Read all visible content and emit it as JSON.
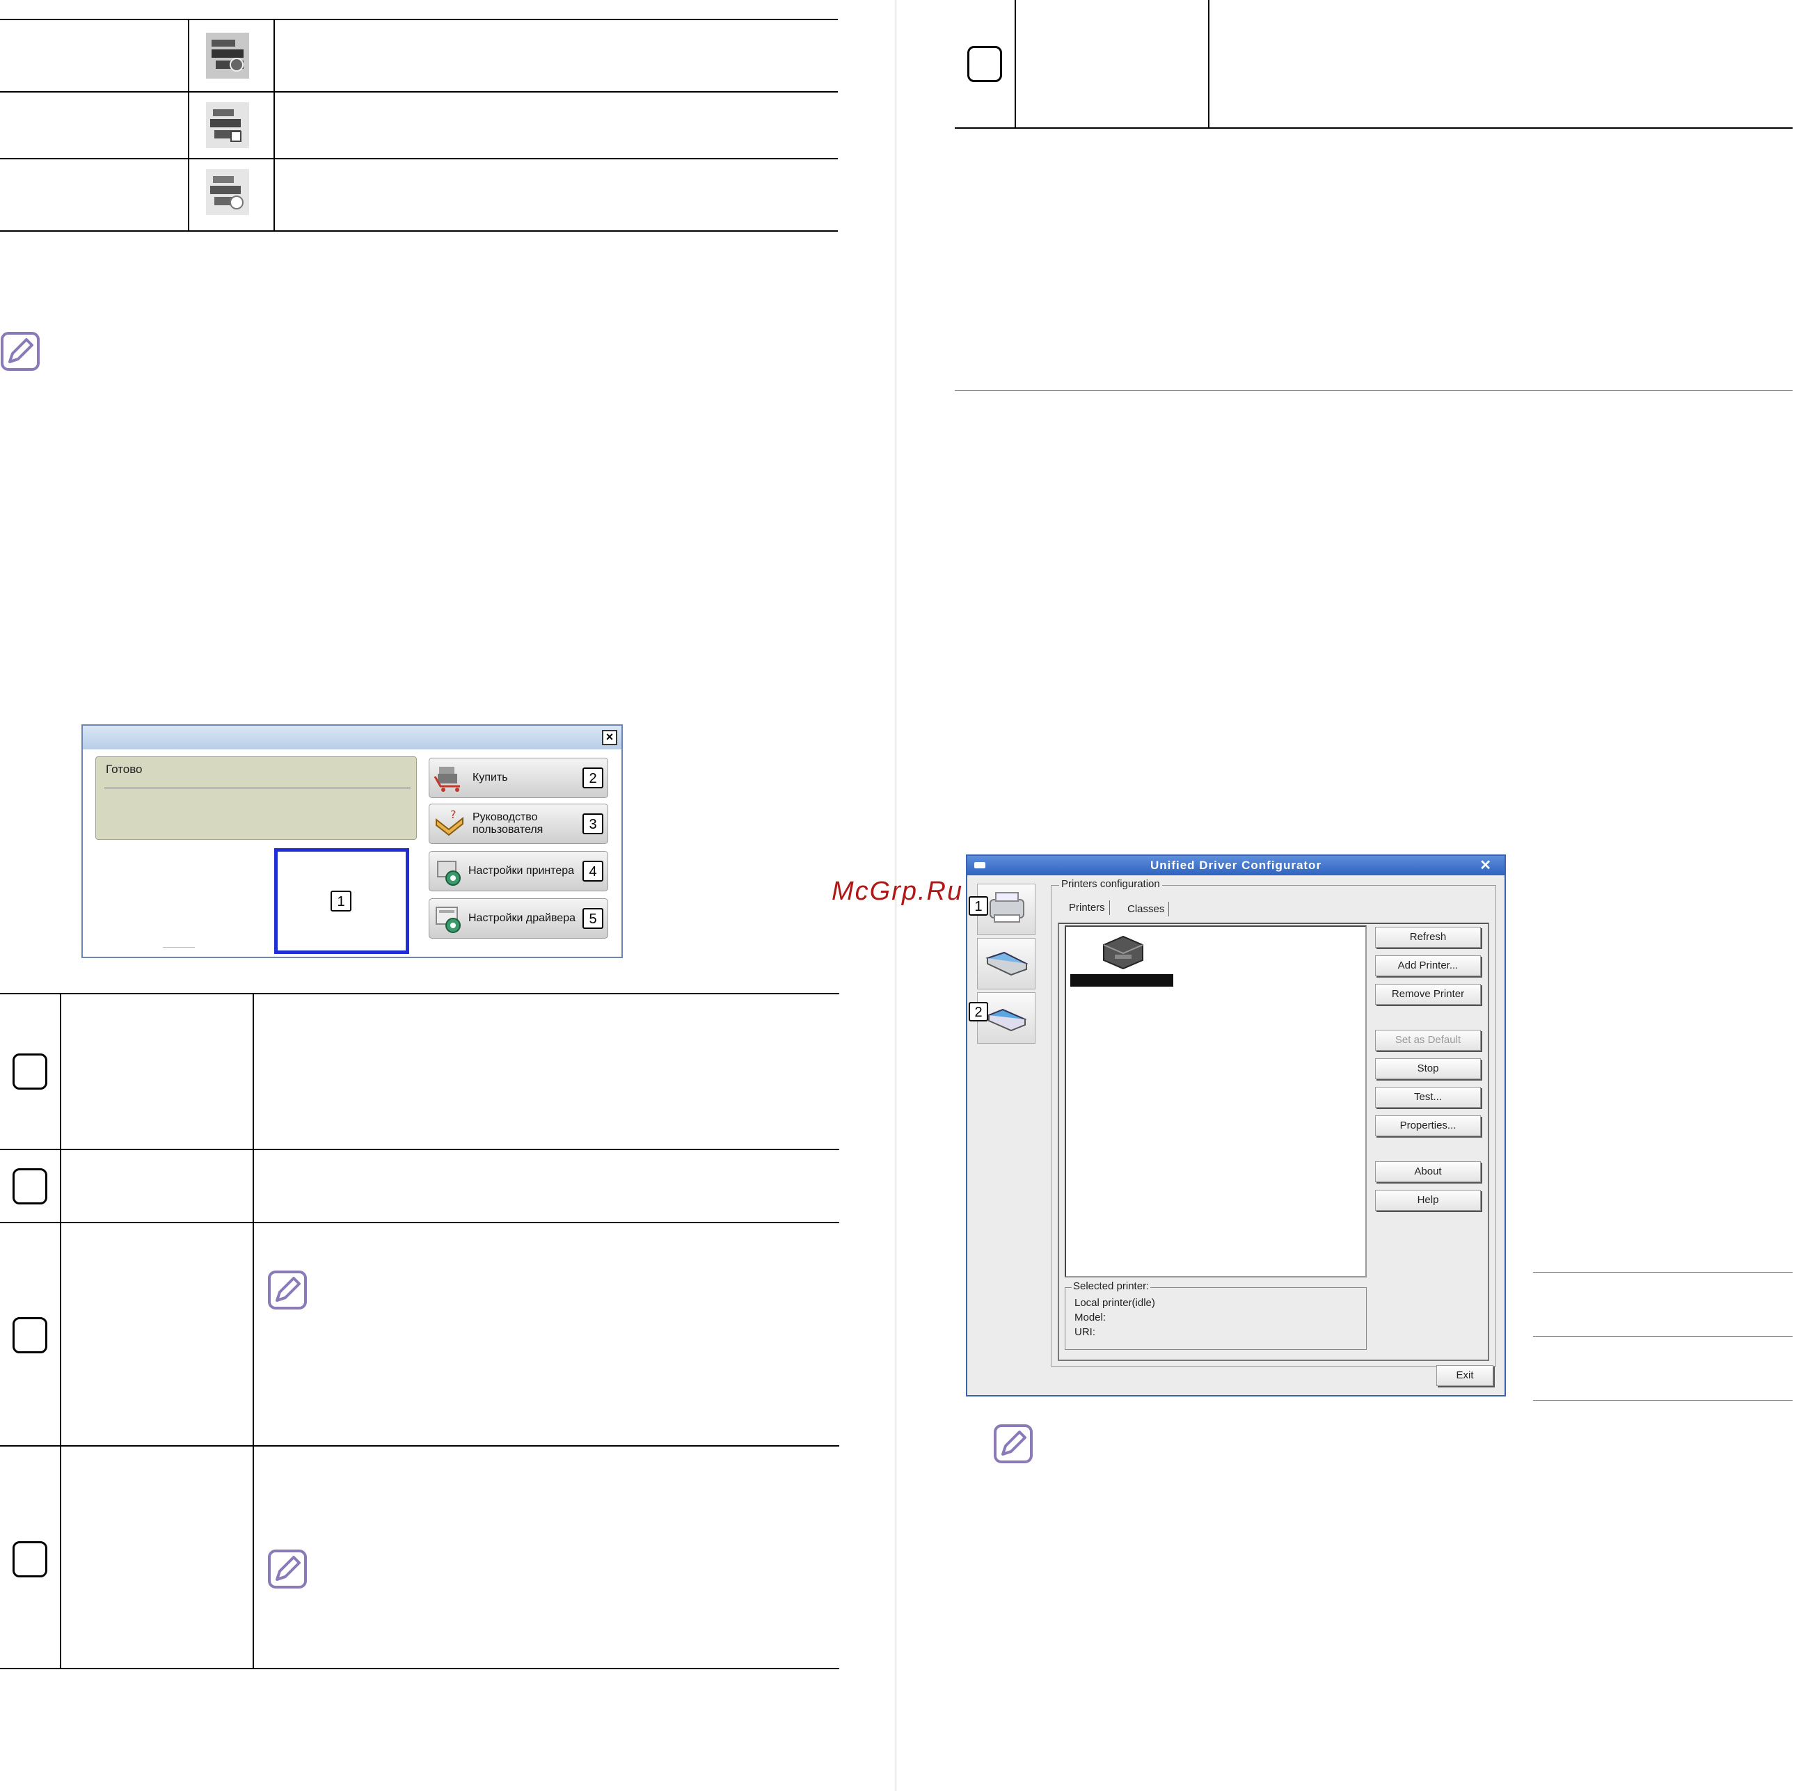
{
  "watermark": "McGrp.Ru",
  "status_window": {
    "message": "Готово",
    "buttons": [
      {
        "label": "Купить",
        "callout": "2"
      },
      {
        "label_line1": "Руководство",
        "label_line2": "пользователя",
        "callout": "3"
      },
      {
        "label": "Настройки принтера",
        "callout": "4"
      },
      {
        "label": "Настройки драйвера",
        "callout": "5"
      }
    ],
    "callout_1": "1"
  },
  "udc": {
    "title": "Unified Driver Configurator",
    "close": "✕",
    "side_callouts": [
      "1",
      "2"
    ],
    "group_title": "Printers configuration",
    "tabs": [
      "Printers",
      "Classes"
    ],
    "buttons": {
      "refresh": "Refresh",
      "add_printer": "Add Printer...",
      "remove_printer": "Remove Printer",
      "set_default": "Set as Default",
      "stop": "Stop",
      "test": "Test...",
      "properties": "Properties...",
      "about": "About",
      "help": "Help",
      "exit": "Exit"
    },
    "selected": {
      "title": "Selected printer:",
      "line1": "Local printer(idle)",
      "line2": "Model:",
      "line3": "URI:"
    }
  },
  "colors": {
    "frame_blue": "#1f2fd4",
    "note_icon": "#8a7ab8",
    "udc_title": "#2f63be"
  },
  "icons": [
    "printer-status-icon",
    "note-icon",
    "printer-icon",
    "scanner-icon",
    "port-icon"
  ]
}
